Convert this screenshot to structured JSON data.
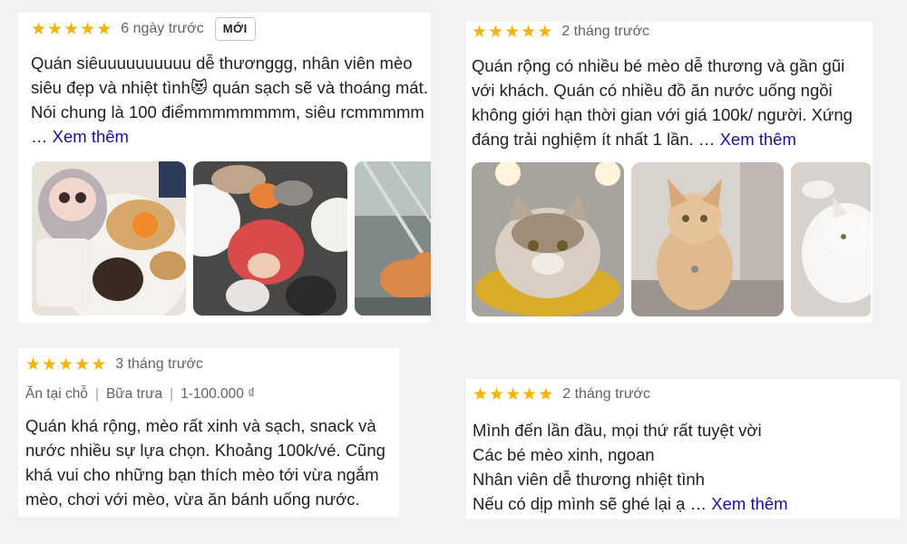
{
  "reviews": [
    {
      "rating": 5,
      "date": "6 ngày trước",
      "badge": "MỚI",
      "text": "Quán siêuuuuuuuuuu dễ thươnggg, nhân viên mèo siêu đẹp và nhiệt tình😻 quán sạch sẽ và thoáng mát. Nói chung là 100 điểmmmmmmmm, siêu rcmmmmm …",
      "more": "Xem thêm",
      "photos": [
        "cafe-table-photo",
        "cats-and-child-photo",
        "orange-cat-photo"
      ]
    },
    {
      "rating": 5,
      "date": "2 tháng trước",
      "text": "Quán rộng có nhiều bé mèo dễ thương và gần gũi với khách. Quán có nhiều đồ ăn nước uống ngồi không giới hạn thời gian với giá 100k/ người. Xứng đáng trải nghiệm ít nhất 1 lần. …",
      "more": "Xem thêm",
      "photos": [
        "tabby-cat-photo",
        "maine-coon-photo",
        "white-cat-photo"
      ]
    },
    {
      "rating": 5,
      "date": "3 tháng trước",
      "meta": [
        "Ăn tại chỗ",
        "Bữa trưa",
        "1-100.000 ₫"
      ],
      "text": "Quán khá rộng, mèo rất xinh và sạch, snack và nước nhiều sự lựa chọn. Khoảng 100k/vé. Cũng khá vui cho những bạn thích mèo tới vừa ngắm mèo, chơi với mèo, vừa ăn bánh uống nước."
    },
    {
      "rating": 5,
      "date": "2 tháng trước",
      "lines": [
        "Mình đến lần đầu, mọi thứ rất tuyệt vời",
        "Các bé mèo xinh, ngoan",
        "Nhân viên dễ thương nhiệt tình",
        "Nếu có dịp mình sẽ ghé lại ạ …"
      ],
      "more": "Xem thêm"
    }
  ],
  "colors": {
    "star": "#f6b400",
    "link": "#1a0dab",
    "muted": "#5f6368"
  }
}
